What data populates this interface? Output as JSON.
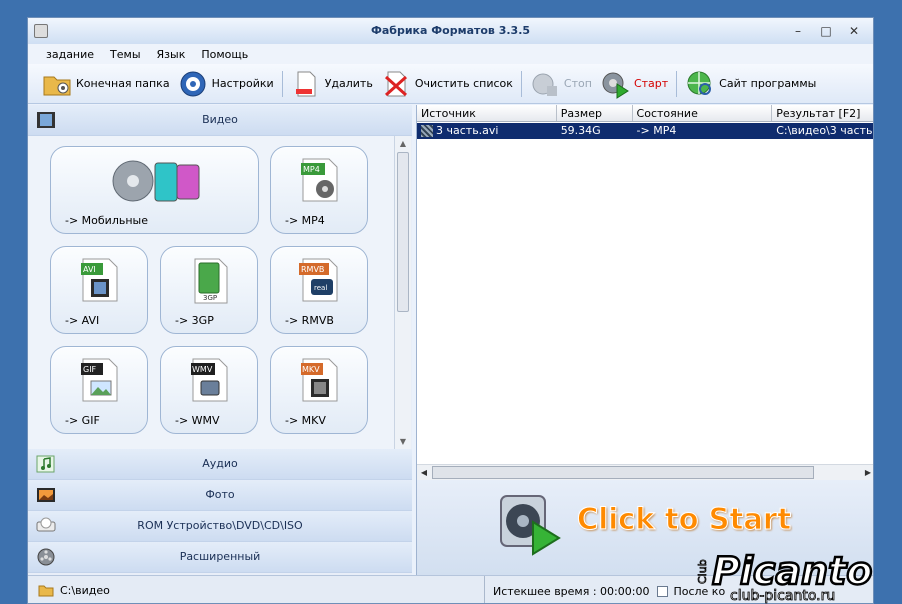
{
  "window": {
    "title": "Фабрика Форматов 3.3.5",
    "min": "–",
    "max": "□",
    "close": "✕"
  },
  "menu": [
    "задание",
    "Темы",
    "Язык",
    "Помощь"
  ],
  "toolbar": {
    "dest_folder": "Конечная папка",
    "settings": "Настройки",
    "delete": "Удалить",
    "clear_list": "Очистить список",
    "stop": "Стоп",
    "start": "Старт",
    "website": "Сайт программы"
  },
  "categories": {
    "video": "Видео",
    "audio": "Аудио",
    "photo": "Фото",
    "rom": "ROM Устройство\\DVD\\CD\\ISO",
    "advanced": "Расширенный"
  },
  "tiles": {
    "mobile": "-> Мобильные",
    "mp4": "-> MP4",
    "avi": "-> AVI",
    "3gp": "-> 3GP",
    "rmvb": "-> RMVB",
    "gif": "-> GIF",
    "wmv": "-> WMV",
    "mkv": "-> MKV"
  },
  "icon_labels": {
    "mp4": "MP4",
    "avi": "AVI",
    "3gp": "3GP",
    "rmvb": "RMVB",
    "real": "real",
    "gif": "GIF",
    "wmv": "WMV",
    "mkv": "MKV"
  },
  "list": {
    "columns": [
      "Источник",
      "Размер",
      "Состояние",
      "Результат [F2]"
    ],
    "rows": [
      {
        "source": "3 часть.avi",
        "size": "59.34G",
        "state": "-> MP4",
        "result": "C:\\видео\\3 часть"
      }
    ]
  },
  "click_to_start": "Click to Start",
  "status": {
    "folder": "C:\\видео",
    "elapsed": "Истекшее время : 00:00:00",
    "after": "После ко"
  },
  "watermark": {
    "brand": "Picanto",
    "club": "Club",
    "url": "club-picanto.ru"
  },
  "colors": {
    "selection": "#0f2c6e",
    "start_text": "#ff8a00",
    "stop_text_disabled": "#9aa6b5",
    "start_label": "#d40000"
  }
}
